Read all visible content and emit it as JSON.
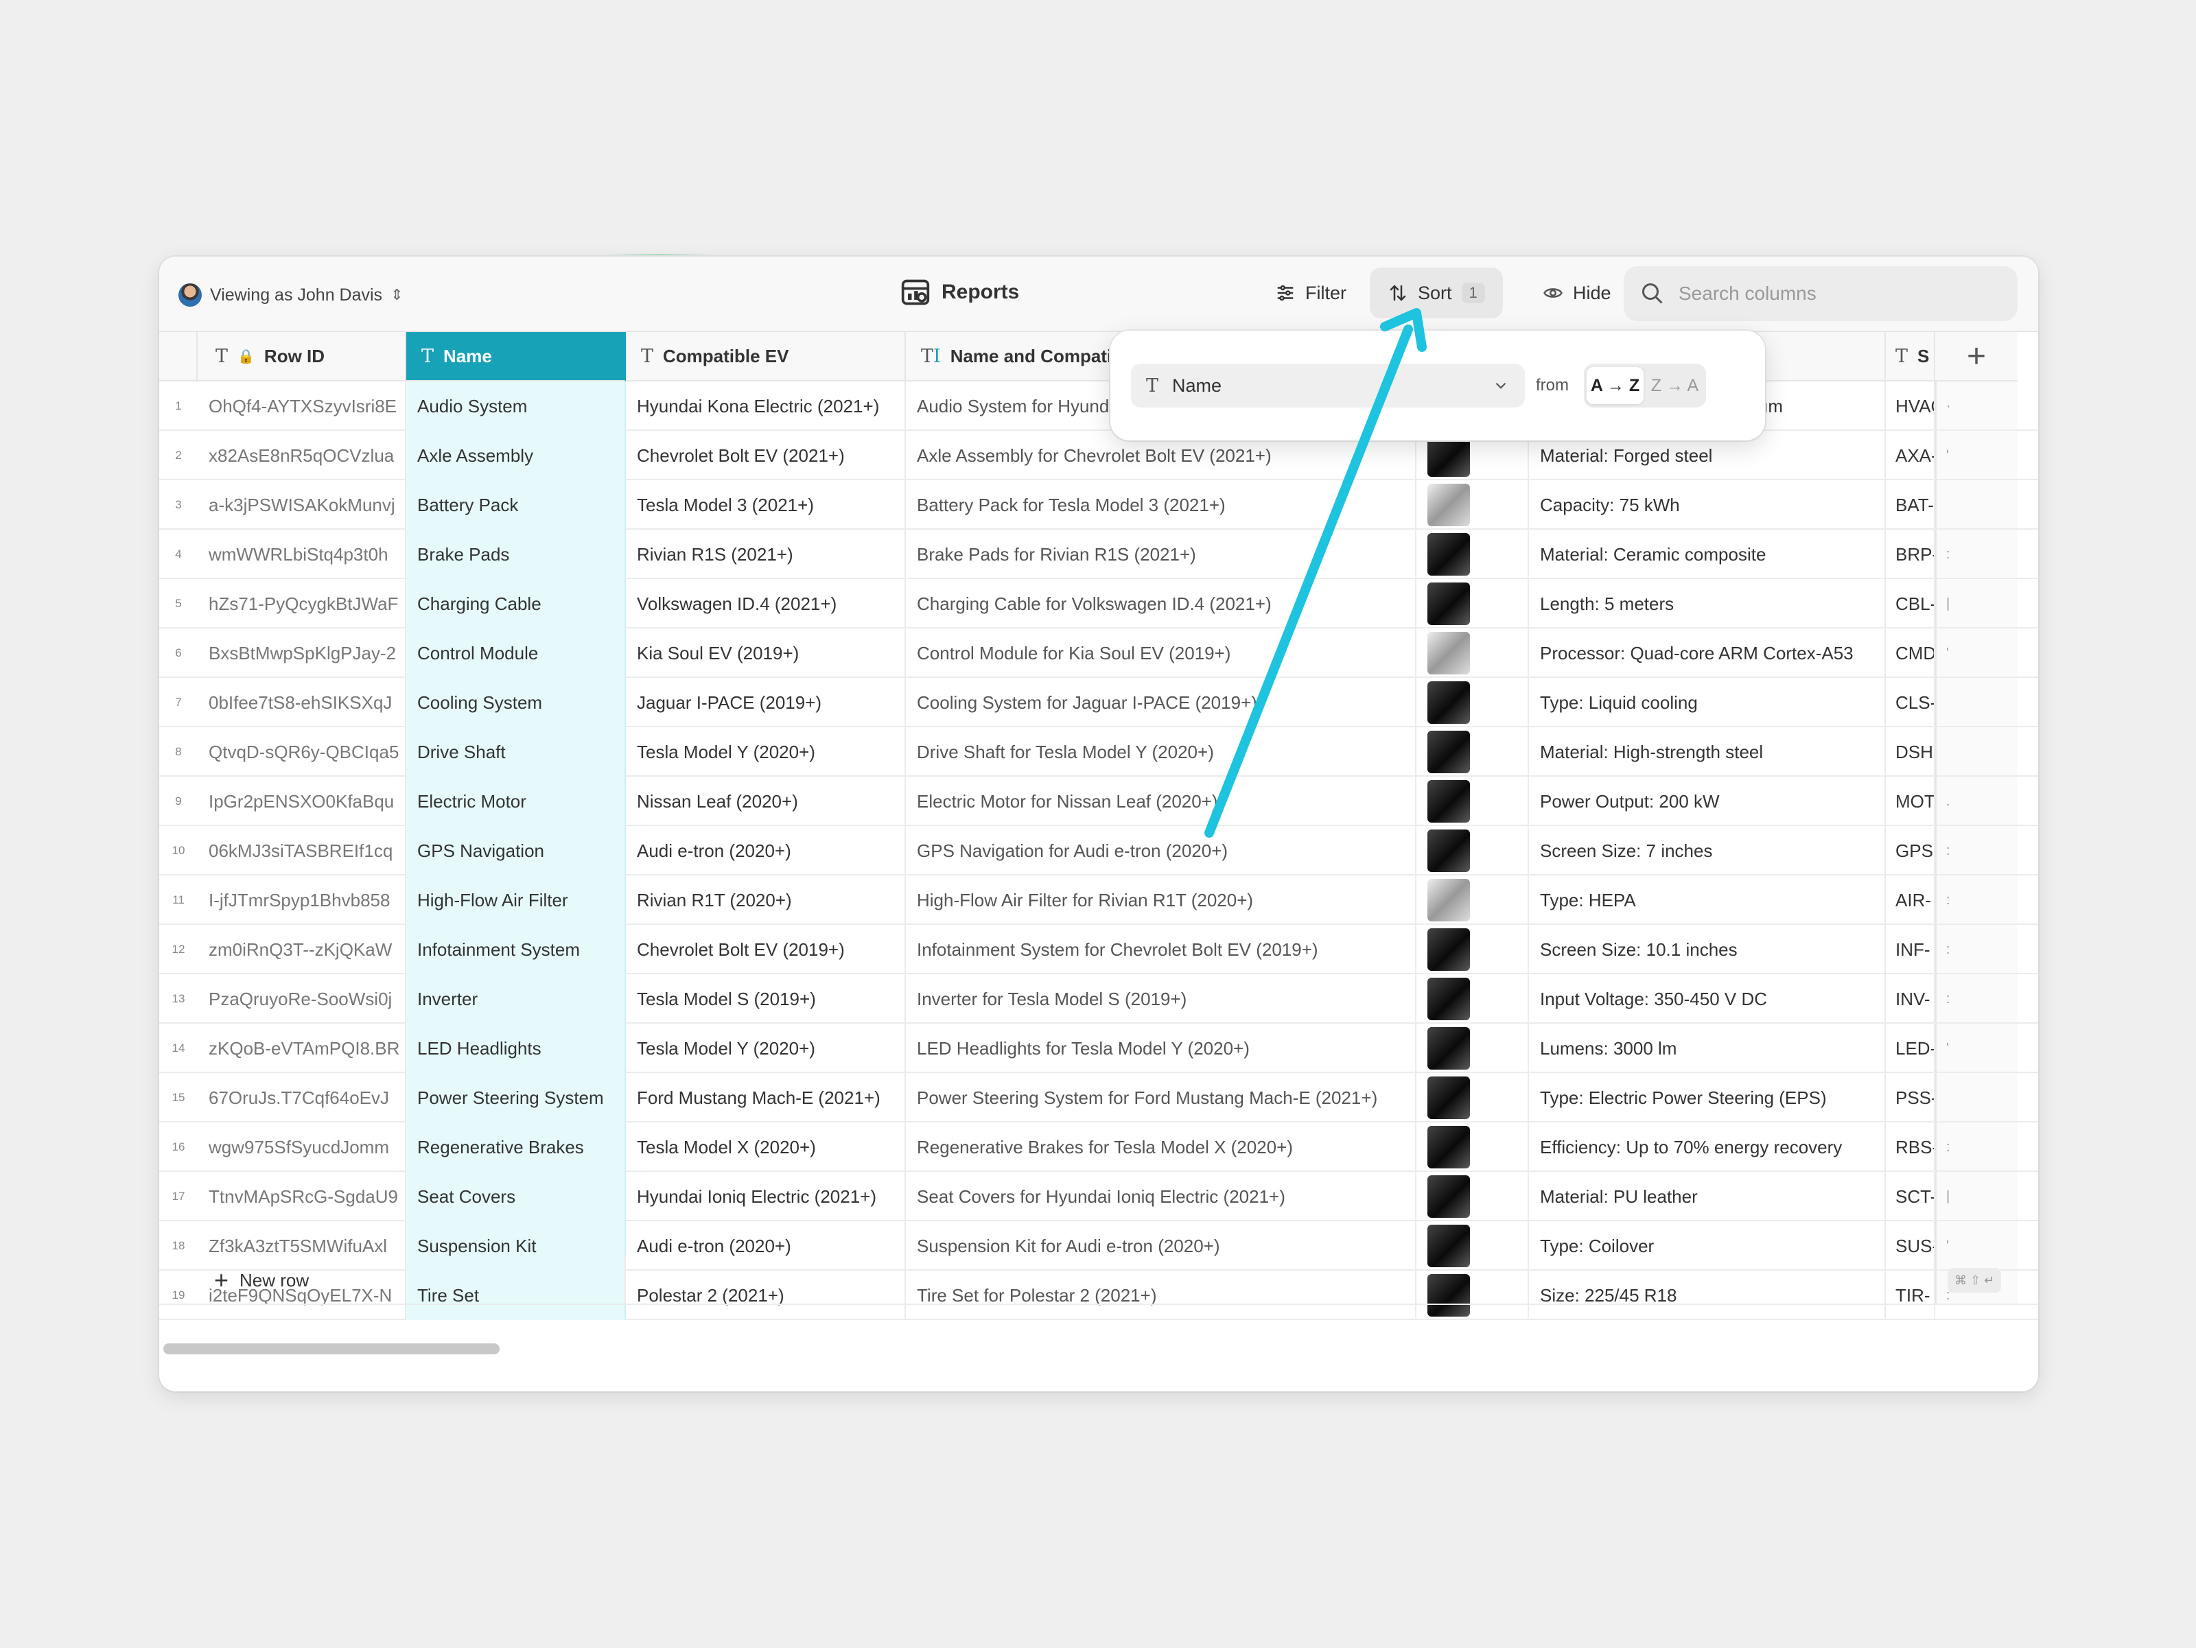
{
  "toolbar": {
    "viewing_label": "Viewing as John Davis",
    "title": "Reports",
    "filter_label": "Filter",
    "sort_label": "Sort",
    "sort_count": "1",
    "hide_label": "Hide",
    "search_placeholder": "Search columns"
  },
  "columns": {
    "row_id": "Row ID",
    "name": "Name",
    "compatible_ev": "Compatible EV",
    "name_compat": "Name and Compati",
    "sku_prefix": "S"
  },
  "sort_popover": {
    "field": "Name",
    "from_label": "from",
    "asc_label": "A → Z",
    "desc_label": "Z → A"
  },
  "rows": [
    {
      "num": "1",
      "row_id": "OhQf4-AYTXSzyvIsri8E",
      "name": "Audio System",
      "ev": "Hyundai Kona Electric (2021+)",
      "nc": "Audio System for Hyundai Kona Electric (2021+)",
      "spec": "Material: Plastic and aluminum",
      "sku": "HVAC",
      "extra": "·"
    },
    {
      "num": "2",
      "row_id": "x82AsE8nR5qOCVzlua",
      "name": "Axle Assembly",
      "ev": "Chevrolet Bolt EV (2021+)",
      "nc": "Axle Assembly for Chevrolet Bolt EV (2021+)",
      "spec": "Material: Forged steel",
      "sku": "AXA-",
      "extra": "'"
    },
    {
      "num": "3",
      "row_id": "a-k3jPSWISAKokMunvj",
      "name": "Battery Pack",
      "ev": "Tesla Model 3 (2021+)",
      "nc": "Battery Pack for Tesla Model 3 (2021+)",
      "spec": "Capacity: 75 kWh",
      "sku": "BAT-",
      "extra": ""
    },
    {
      "num": "4",
      "row_id": "wmWWRLbiStq4p3t0h",
      "name": "Brake Pads",
      "ev": "Rivian R1S (2021+)",
      "nc": "Brake Pads for Rivian R1S (2021+)",
      "spec": "Material: Ceramic composite",
      "sku": "BRP-",
      "extra": ":"
    },
    {
      "num": "5",
      "row_id": "hZs71-PyQcygkBtJWaF",
      "name": "Charging Cable",
      "ev": "Volkswagen ID.4 (2021+)",
      "nc": "Charging Cable for Volkswagen ID.4 (2021+)",
      "spec": "Length: 5 meters",
      "sku": "CBL-",
      "extra": "|"
    },
    {
      "num": "6",
      "row_id": "BxsBtMwpSpKlgPJay-2",
      "name": "Control Module",
      "ev": "Kia Soul EV (2019+)",
      "nc": "Control Module for Kia Soul EV (2019+)",
      "spec": "Processor: Quad-core ARM Cortex-A53",
      "sku": "CMD",
      "extra": "'"
    },
    {
      "num": "7",
      "row_id": "0bIfee7tS8-ehSIKSXqJ",
      "name": "Cooling System",
      "ev": "Jaguar I-PACE (2019+)",
      "nc": "Cooling System for Jaguar I-PACE (2019+)",
      "spec": "Type: Liquid cooling",
      "sku": "CLS-",
      "extra": ""
    },
    {
      "num": "8",
      "row_id": "QtvqD-sQR6y-QBCIqa5",
      "name": "Drive Shaft",
      "ev": "Tesla Model Y (2020+)",
      "nc": "Drive Shaft for Tesla Model Y (2020+)",
      "spec": "Material: High-strength steel",
      "sku": "DSH-",
      "extra": ""
    },
    {
      "num": "9",
      "row_id": "IpGr2pENSXO0KfaBqu",
      "name": "Electric Motor",
      "ev": "Nissan Leaf (2020+)",
      "nc": "Electric Motor for Nissan Leaf (2020+)",
      "spec": "Power Output: 200 kW",
      "sku": "MOT",
      "extra": "."
    },
    {
      "num": "10",
      "row_id": "06kMJ3siTASBREIf1cq",
      "name": "GPS Navigation",
      "ev": "Audi e-tron (2020+)",
      "nc": "GPS Navigation for Audi e-tron (2020+)",
      "spec": "Screen Size: 7 inches",
      "sku": "GPS-",
      "extra": ":"
    },
    {
      "num": "11",
      "row_id": "I-jfJTmrSpyp1Bhvb858",
      "name": "High-Flow Air Filter",
      "ev": "Rivian R1T (2020+)",
      "nc": "High-Flow Air Filter for Rivian R1T (2020+)",
      "spec": "Type: HEPA",
      "sku": "AIR-",
      "extra": ":"
    },
    {
      "num": "12",
      "row_id": "zm0iRnQ3T--zKjQKaW",
      "name": "Infotainment System",
      "ev": "Chevrolet Bolt EV (2019+)",
      "nc": "Infotainment System for Chevrolet Bolt EV (2019+)",
      "spec": "Screen Size: 10.1 inches",
      "sku": "INF-",
      "extra": ":"
    },
    {
      "num": "13",
      "row_id": "PzaQruyoRe-SooWsi0j",
      "name": "Inverter",
      "ev": "Tesla Model S (2019+)",
      "nc": "Inverter for Tesla Model S (2019+)",
      "spec": "Input Voltage: 350-450 V DC",
      "sku": "INV-",
      "extra": ":"
    },
    {
      "num": "14",
      "row_id": "zKQoB-eVTAmPQI8.BR",
      "name": "LED Headlights",
      "ev": "Tesla Model Y (2020+)",
      "nc": "LED Headlights for Tesla Model Y (2020+)",
      "spec": "Lumens: 3000 lm",
      "sku": "LED-",
      "extra": "'"
    },
    {
      "num": "15",
      "row_id": "67OruJs.T7Cqf64oEvJ",
      "name": "Power Steering System",
      "ev": "Ford Mustang Mach-E (2021+)",
      "nc": "Power Steering System for Ford Mustang Mach-E (2021+)",
      "spec": "Type: Electric Power Steering (EPS)",
      "sku": "PSS-",
      "extra": ""
    },
    {
      "num": "16",
      "row_id": "wgw975SfSyucdJomm",
      "name": "Regenerative Brakes",
      "ev": "Tesla Model X (2020+)",
      "nc": "Regenerative Brakes for Tesla Model X (2020+)",
      "spec": "Efficiency: Up to 70% energy recovery",
      "sku": "RBS-",
      "extra": ":"
    },
    {
      "num": "17",
      "row_id": "TtnvMApSRcG-SgdaU9",
      "name": "Seat Covers",
      "ev": "Hyundai Ioniq Electric (2021+)",
      "nc": "Seat Covers for Hyundai Ioniq Electric (2021+)",
      "spec": "Material: PU leather",
      "sku": "SCT-",
      "extra": "|"
    },
    {
      "num": "18",
      "row_id": "Zf3kA3ztT5SMWifuAxl",
      "name": "Suspension Kit",
      "ev": "Audi e-tron (2020+)",
      "nc": "Suspension Kit for Audi e-tron (2020+)",
      "spec": "Type: Coilover",
      "sku": "SUS-",
      "extra": "'"
    },
    {
      "num": "19",
      "row_id": "i2teF9QNSqOyEL7X-N",
      "name": "Tire Set",
      "ev": "Polestar 2 (2021+)",
      "nc": "Tire Set for Polestar 2 (2021+)",
      "spec": "Size: 225/45 R18",
      "sku": "TIR-",
      "extra": ":"
    }
  ],
  "new_row_label": "New row",
  "shortcut_hint": "⌘ ⇧ ↵",
  "colors": {
    "accent": "#17a2b8",
    "name_column_bg": "#e6fafb",
    "arrow": "#1ec3e0"
  }
}
